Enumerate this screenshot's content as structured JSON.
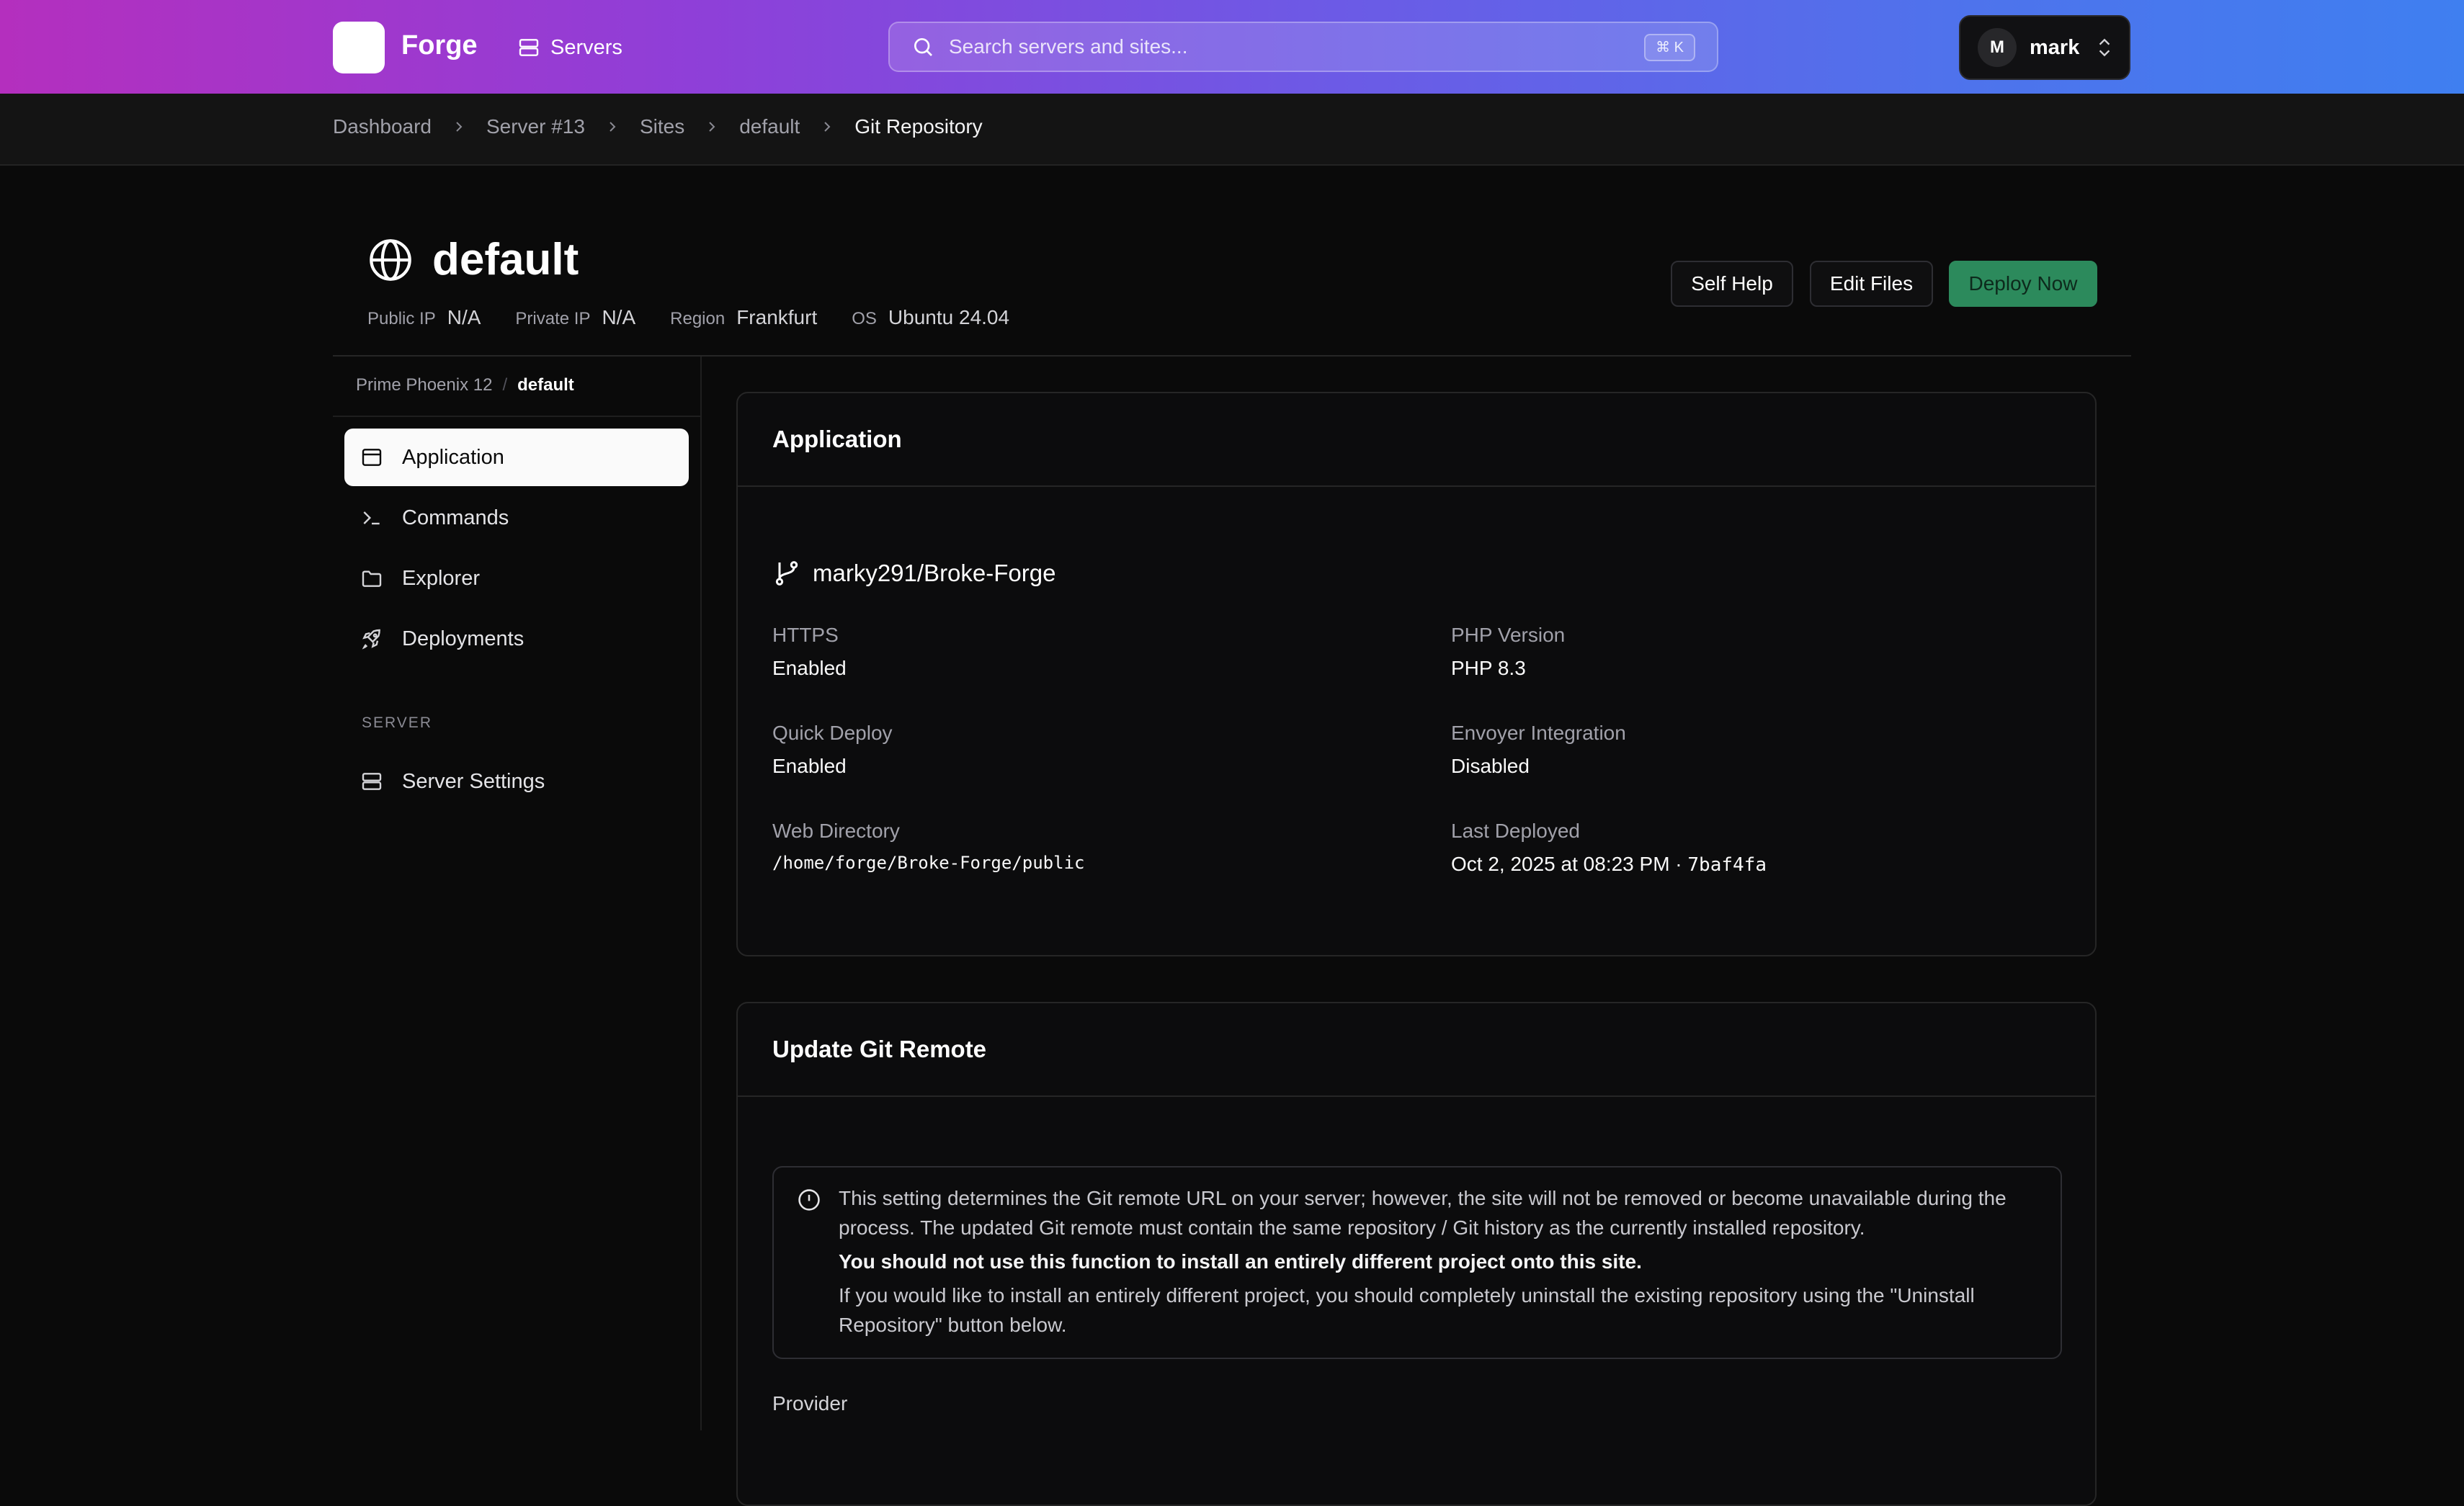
{
  "topbar": {
    "brand": "Forge",
    "nav_servers": "Servers",
    "search_placeholder": "Search servers and sites...",
    "search_shortcut": "⌘ K",
    "user_initial": "M",
    "user_name": "mark"
  },
  "breadcrumb": [
    "Dashboard",
    "Server #13",
    "Sites",
    "default",
    "Git Repository"
  ],
  "site": {
    "title": "default",
    "meta": {
      "public_ip_label": "Public IP",
      "public_ip": "N/A",
      "private_ip_label": "Private IP",
      "private_ip": "N/A",
      "region_label": "Region",
      "region": "Frankfurt",
      "os_label": "OS",
      "os": "Ubuntu 24.04"
    },
    "actions": {
      "self_help": "Self Help",
      "edit_files": "Edit Files",
      "deploy_now": "Deploy Now"
    }
  },
  "sidebar": {
    "crumb_parent": "Prime Phoenix 12",
    "crumb_current": "default",
    "items": [
      {
        "label": "Application",
        "icon": "application-icon",
        "active": true
      },
      {
        "label": "Commands",
        "icon": "terminal-icon"
      },
      {
        "label": "Explorer",
        "icon": "folder-icon"
      },
      {
        "label": "Deployments",
        "icon": "rocket-icon"
      }
    ],
    "server_section": "SERVER",
    "server_items": [
      {
        "label": "Server Settings",
        "icon": "server-icon"
      }
    ]
  },
  "application": {
    "title": "Application",
    "repository": "marky291/Broke-Forge",
    "https_label": "HTTPS",
    "https": "Enabled",
    "php_label": "PHP Version",
    "php": "PHP 8.3",
    "quick_deploy_label": "Quick Deploy",
    "quick_deploy": "Enabled",
    "envoyer_label": "Envoyer Integration",
    "envoyer": "Disabled",
    "web_dir_label": "Web Directory",
    "web_dir": "/home/forge/Broke-Forge/public",
    "last_deployed_label": "Last Deployed",
    "last_deployed": "Oct 2, 2025 at 08:23 PM",
    "last_deployed_sep": " · ",
    "last_commit": "7baf4fa"
  },
  "git_remote": {
    "title": "Update Git Remote",
    "alert_p1": "This setting determines the Git remote URL on your server; however, the site will not be removed or become unavailable during the process. The updated Git remote must contain the same repository / Git history as the currently installed repository.",
    "alert_strong": "You should not use this function to install an entirely different project onto this site.",
    "alert_p3": "If you would like to install an entirely different project, you should completely uninstall the existing repository using the \"Uninstall Repository\" button below.",
    "provider_label": "Provider"
  },
  "colors": {
    "gradient_start": "#b42fbe",
    "gradient_end": "#3f7ff0",
    "deploy_button": "#2c8a5c",
    "background": "#0a0a0a"
  }
}
